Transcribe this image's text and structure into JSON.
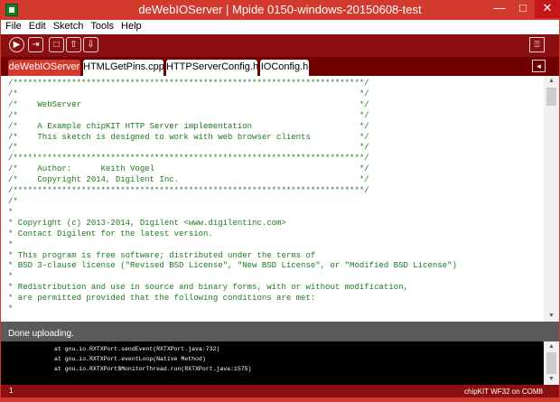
{
  "window": {
    "title": "deWebIOServer | Mpide 0150-windows-20150608-test",
    "minimize": "—",
    "maximize": "□",
    "close": "✕"
  },
  "menu": [
    "File",
    "Edit",
    "Sketch",
    "Tools",
    "Help"
  ],
  "toolbar": {
    "buttons": [
      {
        "name": "verify",
        "glyph": "▶",
        "round": true
      },
      {
        "name": "upload",
        "glyph": "⇥"
      },
      {
        "name": "new",
        "glyph": "□"
      },
      {
        "name": "open",
        "glyph": "⇧"
      },
      {
        "name": "save",
        "glyph": "⇩"
      }
    ],
    "serial_glyph": "⍐"
  },
  "tabs": [
    {
      "label": "deWebIOServer",
      "active": true
    },
    {
      "label": "HTMLGetPins.cpp",
      "active": false
    },
    {
      "label": "HTTPServerConfig.h",
      "active": false
    },
    {
      "label": "IOConfig.h",
      "active": false
    }
  ],
  "tab_menu_glyph": "◂",
  "code_lines": [
    "/************************************************************************/",
    "/*                                                                      */",
    "/*    WebServer                                                         */",
    "/*                                                                      */",
    "/*    A Example chipKIT HTTP Server implementation                      */",
    "/*    This sketch is designed to work with web browser clients          */",
    "/*                                                                      */",
    "/************************************************************************/",
    "/*    Author:      Keith Vogel                                          */",
    "/*    Copyright 2014, Digilent Inc.                                     */",
    "/************************************************************************/",
    "/*",
    "*",
    "* Copyright (c) 2013-2014, Digilent <www.digilentinc.com>",
    "* Contact Digilent for the latest version.",
    "*",
    "* This program is free software; distributed under the terms of",
    "* BSD 3-clause license (\"Revised BSD License\", \"New BSD License\", or \"Modified BSD License\")",
    "*",
    "* Redistribution and use in source and binary forms, with or without modification,",
    "* are permitted provided that the following conditions are met:",
    "*"
  ],
  "status": "Done uploading.",
  "console_lines": [
    "at gnu.io.RXTXPort.sendEvent(RXTXPort.java:732)",
    "at gnu.io.RXTXPort.eventLoop(Native Method)",
    "at gnu.io.RXTXPort$MonitorThread.run(RXTXPort.java:1575)"
  ],
  "bottom": {
    "line_number": "1",
    "board": "chipKIT WF32 on COM8"
  }
}
